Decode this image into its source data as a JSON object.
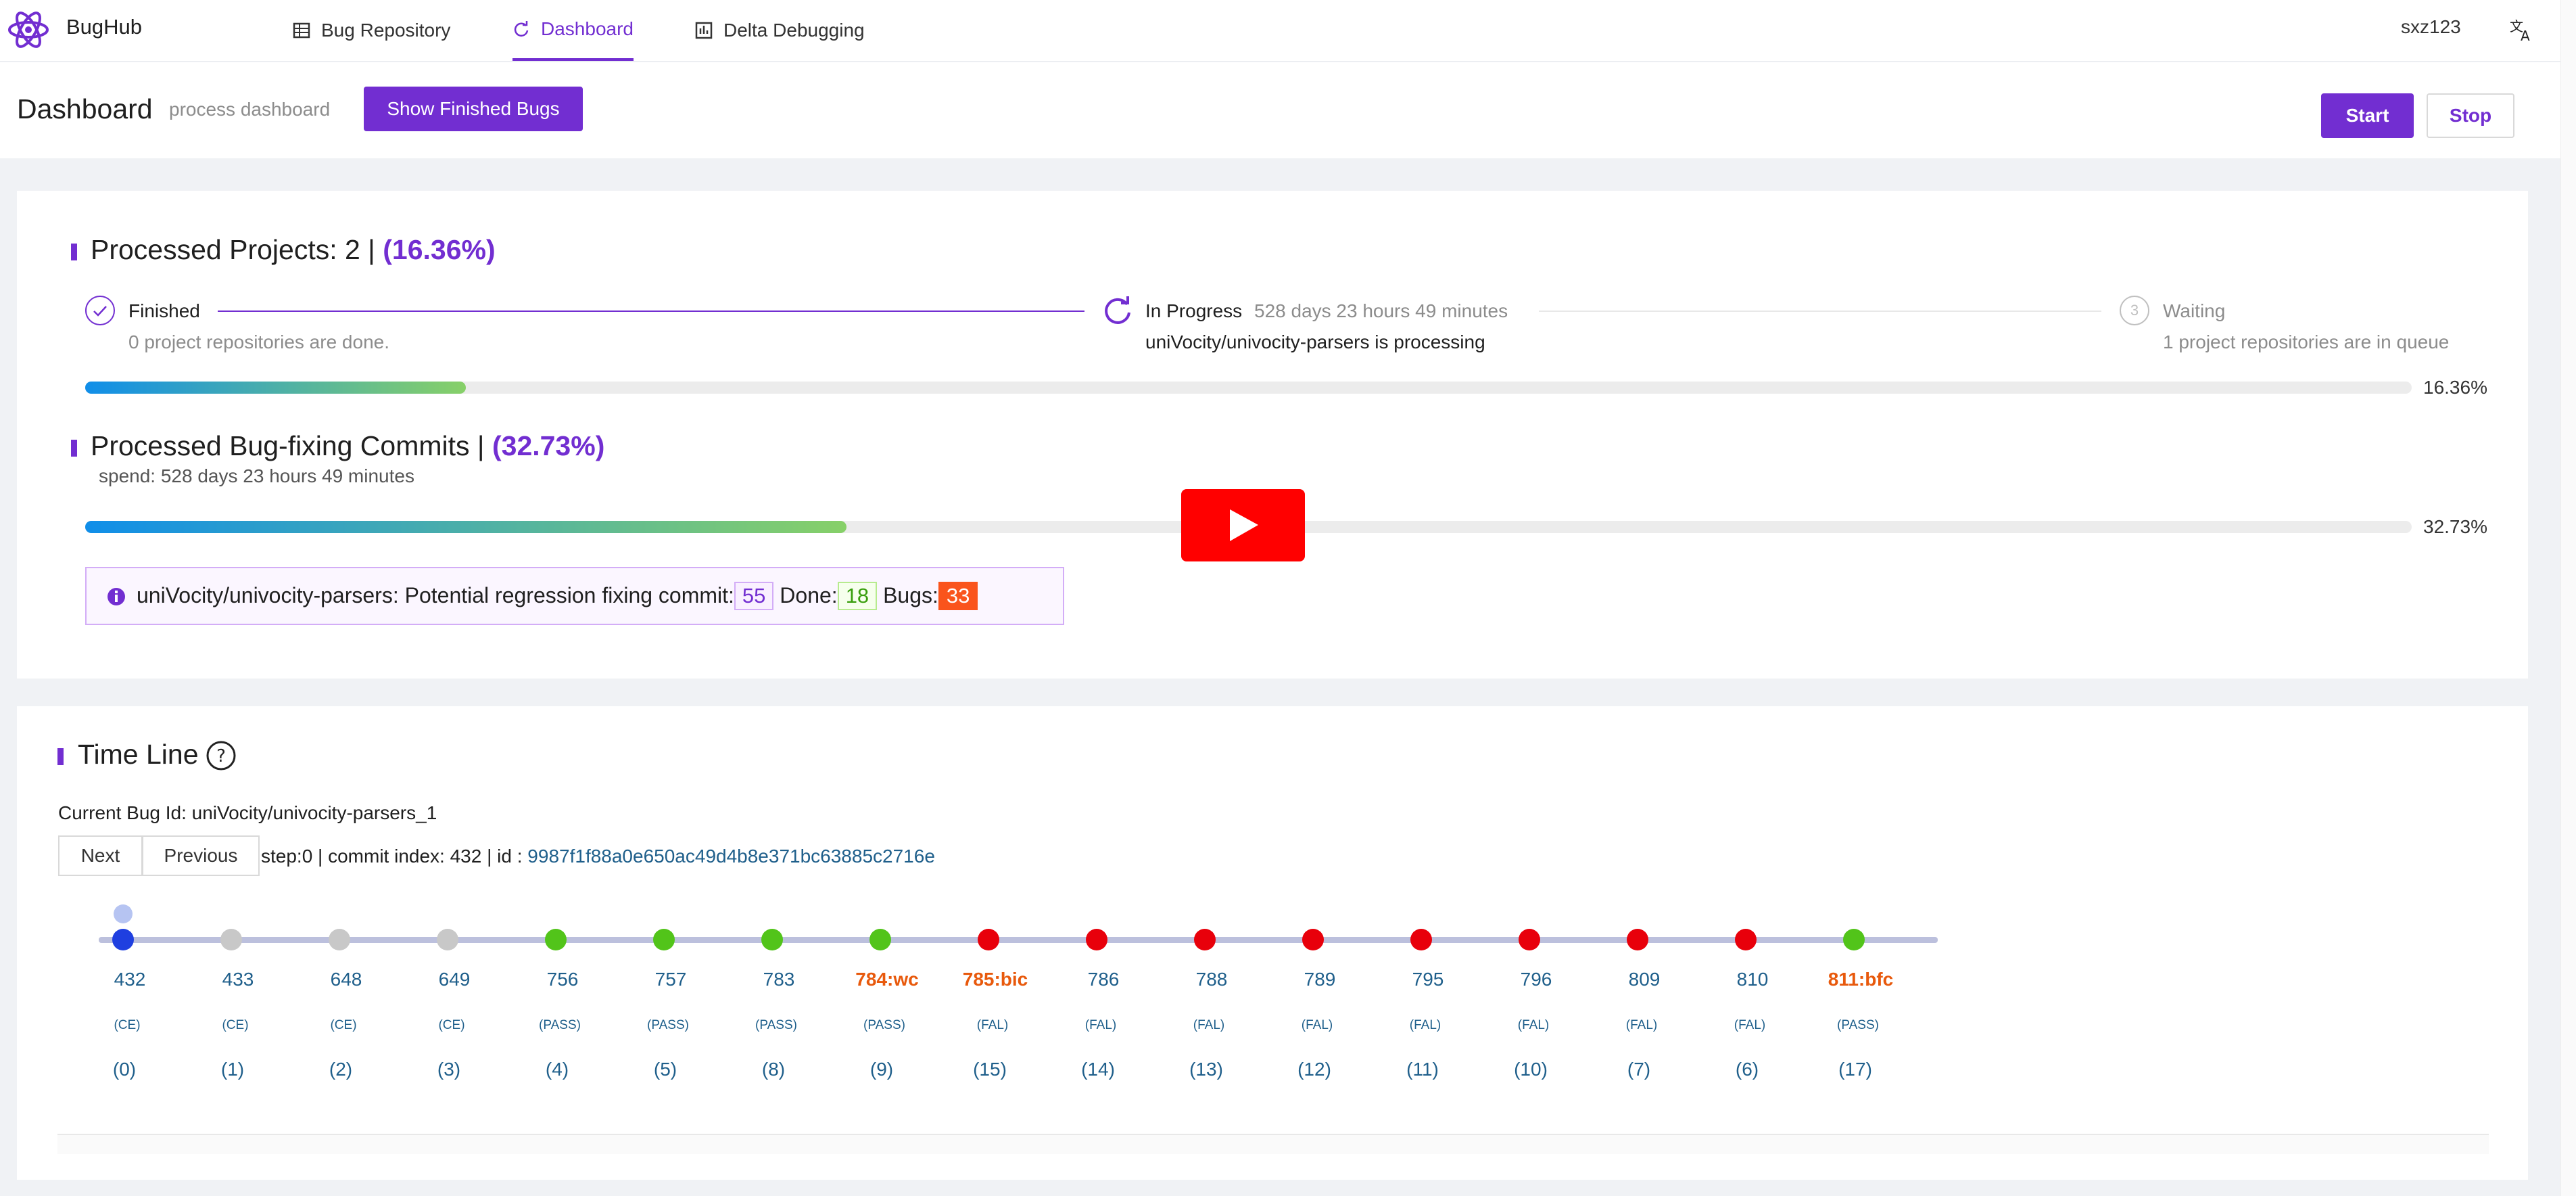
{
  "app": {
    "name": "BugHub"
  },
  "nav": [
    {
      "label": "Bug Repository",
      "icon": "table-icon",
      "active": false
    },
    {
      "label": "Dashboard",
      "icon": "sync-icon",
      "active": true
    },
    {
      "label": "Delta Debugging",
      "icon": "chart-icon",
      "active": false
    }
  ],
  "user": {
    "name": "sxz123"
  },
  "page": {
    "title": "Dashboard",
    "subtitle": "process dashboard",
    "show_finished_label": "Show Finished Bugs",
    "start_label": "Start",
    "stop_label": "Stop"
  },
  "projects": {
    "title_prefix": "Processed Projects: 2 |",
    "title_percent": "(16.36%)",
    "steps": [
      {
        "label": "Finished",
        "extra": "",
        "desc": "0 project repositories are done.",
        "state": "finished"
      },
      {
        "label": "In Progress",
        "extra": "528 days 23 hours 49 minutes",
        "desc": "uniVocity/univocity-parsers is processing",
        "state": "progress"
      },
      {
        "number": "3",
        "label": "Waiting",
        "extra": "",
        "desc": "1 project repositories are in queue",
        "state": "waiting"
      }
    ],
    "progress": 0.1636,
    "progress_label": "16.36%"
  },
  "commits": {
    "title_prefix": "Processed Bug-fixing Commits |",
    "title_percent": "(32.73%)",
    "spend": "spend: 528 days 23 hours 49 minutes",
    "progress": 0.3273,
    "progress_label": "32.73%",
    "info": {
      "text": "uniVocity/univocity-parsers: Potential regression fixing commit:",
      "potential": "55",
      "done_label": "Done:",
      "done": "18",
      "bugs_label": "Bugs:",
      "bugs": "33"
    }
  },
  "timeline": {
    "title": "Time Line",
    "current_bug": "Current Bug Id: uniVocity/univocity-parsers_1",
    "next_label": "Next",
    "previous_label": "Previous",
    "step_info": "step:0 | commit index: 432 | id :",
    "commit_id": "9987f1f88a0e650ac49d4b8e371bc63885c2716e",
    "nodes": [
      {
        "label": "432",
        "status": "(CE)",
        "order": "(0)",
        "color": "#1f3fe0",
        "highlight": false,
        "current": true
      },
      {
        "label": "433",
        "status": "(CE)",
        "order": "(1)",
        "color": "#c8c8c8",
        "highlight": false
      },
      {
        "label": "648",
        "status": "(CE)",
        "order": "(2)",
        "color": "#c8c8c8",
        "highlight": false
      },
      {
        "label": "649",
        "status": "(CE)",
        "order": "(3)",
        "color": "#c8c8c8",
        "highlight": false
      },
      {
        "label": "756",
        "status": "(PASS)",
        "order": "(4)",
        "color": "#52c41a",
        "highlight": false
      },
      {
        "label": "757",
        "status": "(PASS)",
        "order": "(5)",
        "color": "#52c41a",
        "highlight": false
      },
      {
        "label": "783",
        "status": "(PASS)",
        "order": "(8)",
        "color": "#52c41a",
        "highlight": false
      },
      {
        "label": "784:wc",
        "status": "(PASS)",
        "order": "(9)",
        "color": "#52c41a",
        "highlight": true
      },
      {
        "label": "785:bic",
        "status": "(FAL)",
        "order": "(15)",
        "color": "#e8000b",
        "highlight": true
      },
      {
        "label": "786",
        "status": "(FAL)",
        "order": "(14)",
        "color": "#e8000b",
        "highlight": false
      },
      {
        "label": "788",
        "status": "(FAL)",
        "order": "(13)",
        "color": "#e8000b",
        "highlight": false
      },
      {
        "label": "789",
        "status": "(FAL)",
        "order": "(12)",
        "color": "#e8000b",
        "highlight": false
      },
      {
        "label": "795",
        "status": "(FAL)",
        "order": "(11)",
        "color": "#e8000b",
        "highlight": false
      },
      {
        "label": "796",
        "status": "(FAL)",
        "order": "(10)",
        "color": "#e8000b",
        "highlight": false
      },
      {
        "label": "809",
        "status": "(FAL)",
        "order": "(7)",
        "color": "#e8000b",
        "highlight": false
      },
      {
        "label": "810",
        "status": "(FAL)",
        "order": "(6)",
        "color": "#e8000b",
        "highlight": false
      },
      {
        "label": "811:bfc",
        "status": "(PASS)",
        "order": "(17)",
        "color": "#52c41a",
        "highlight": true
      }
    ]
  },
  "colors": {
    "accent": "#722ed1",
    "link": "#1f5f8b",
    "highlight": "#e8590c",
    "bugs_tag": "#fa541c",
    "done_tag": "#52c41a"
  }
}
